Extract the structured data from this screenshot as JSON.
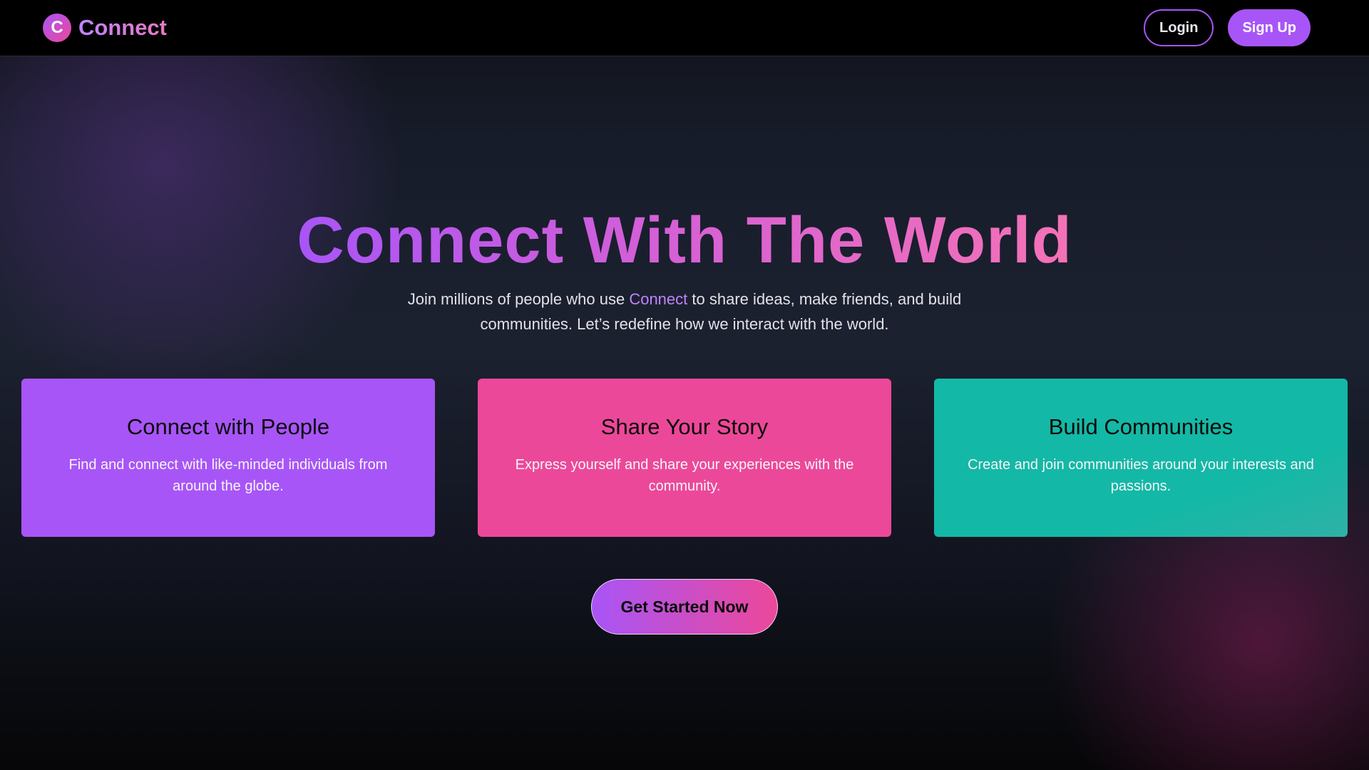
{
  "header": {
    "logo_letter": "C",
    "brand_name": "Connect",
    "login_label": "Login",
    "signup_label": "Sign Up"
  },
  "hero": {
    "title": "Connect With The World",
    "subtitle_before": "Join millions of people who use ",
    "subtitle_accent": "Connect",
    "subtitle_after": " to share ideas, make friends, and build communities. Let’s redefine how we interact with the world."
  },
  "features": [
    {
      "title": "Connect with People",
      "description": "Find and connect with like-minded individuals from around the globe.",
      "color": "#a855f7"
    },
    {
      "title": "Share Your Story",
      "description": "Express yourself and share your experiences with the community.",
      "color": "#ec4899"
    },
    {
      "title": "Build Communities",
      "description": "Create and join communities around your interests and passions.",
      "color": "#14b8a6"
    }
  ],
  "cta": {
    "label": "Get Started Now"
  },
  "colors": {
    "accent_purple": "#a855f7",
    "accent_pink": "#ec4899",
    "accent_teal": "#14b8a6",
    "header_bg": "#000000"
  }
}
